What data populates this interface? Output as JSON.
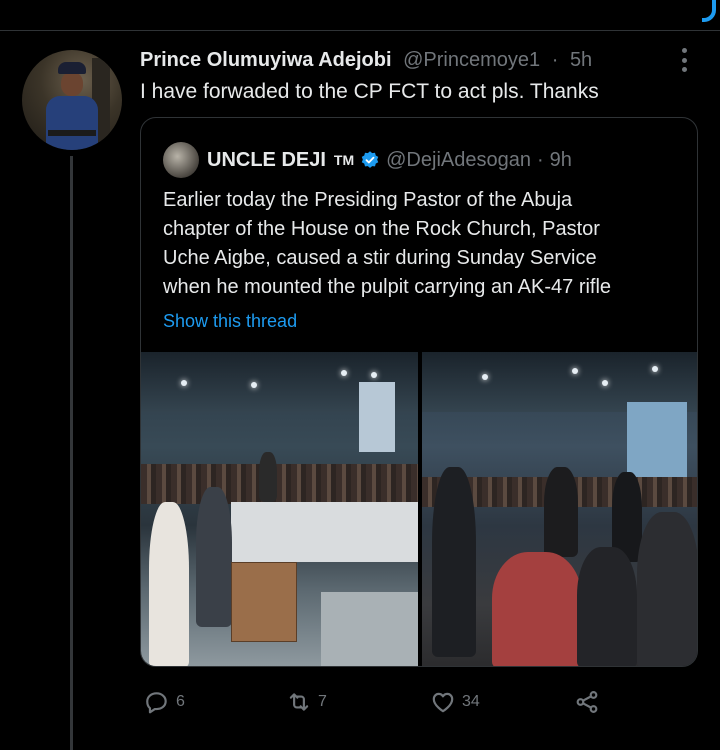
{
  "tweet": {
    "author_name": "Prince Olumuyiwa Adejobi",
    "handle": "@Princemoye1",
    "separator": "·",
    "time": "5h",
    "text": "I have forwaded to the CP FCT to act pls. Thanks"
  },
  "quoted_tweet": {
    "author_name": "UNCLE DEJI",
    "name_suffix": "TM",
    "verified": true,
    "handle": "@DejiAdesogan",
    "separator": "·",
    "time": "9h",
    "text_lines": [
      "Earlier today the Presiding Pastor of the Abuja",
      "chapter of the House on the Rock Church, Pastor",
      "Uche Aigbe, caused a stir during Sunday Service",
      "when he mounted the pulpit carrying an AK-47 rifle"
    ],
    "show_thread_label": "Show this thread",
    "photos": [
      "church-stage-photo-wide",
      "church-stage-photo-close"
    ]
  },
  "actions": {
    "reply": {
      "icon": "reply-icon",
      "count": "6"
    },
    "retweet": {
      "icon": "retweet-icon",
      "count": "7"
    },
    "like": {
      "icon": "heart-icon",
      "count": "34"
    },
    "share": {
      "icon": "share-icon",
      "count": ""
    }
  },
  "colors": {
    "background": "#000000",
    "text": "#e7e9ea",
    "muted": "#71767b",
    "accent": "#1d9bf0",
    "border": "#2f3336"
  }
}
